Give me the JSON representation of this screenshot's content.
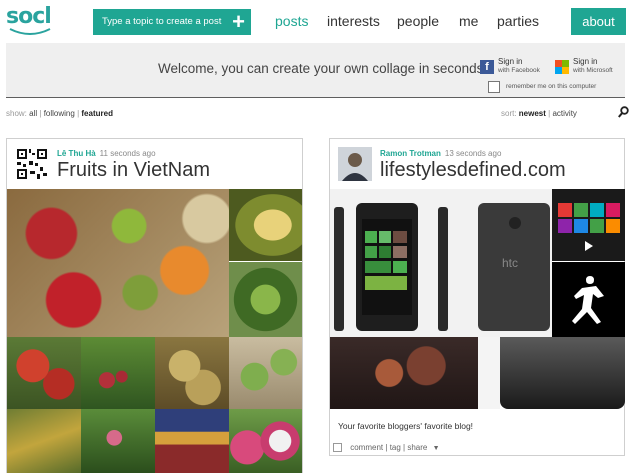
{
  "header": {
    "logo": "socl",
    "create_post": "Type a topic to create a post",
    "create_plus": "+",
    "nav": [
      "posts",
      "interests",
      "people",
      "me",
      "parties"
    ],
    "about": "about"
  },
  "welcome": {
    "text": "Welcome, you can create your own collage in seconds",
    "facebook": {
      "line1": "Sign in",
      "line2": "with Facebook"
    },
    "microsoft": {
      "line1": "Sign in",
      "line2": "with Microsoft"
    },
    "remember": "remember me on this computer"
  },
  "filters": {
    "show_label": "show:",
    "show_options": [
      "all",
      "following",
      "featured"
    ],
    "show_selected": "featured",
    "sort_label": "sort:",
    "sort_options": [
      "newest",
      "activity"
    ],
    "sort_selected": "newest"
  },
  "posts": [
    {
      "author": "Lê Thu Hà",
      "time": "11 seconds ago",
      "title": "Fruits in VietNam"
    },
    {
      "author": "Ramon Trotman",
      "time": "13 seconds ago",
      "title": "lifestylesdefined.com",
      "caption": "Your favorite bloggers' favorite blog!"
    }
  ],
  "actions": [
    "comment",
    "tag",
    "share"
  ],
  "icons": {
    "search": "search-icon",
    "facebook": "facebook-icon",
    "microsoft": "microsoft-icon",
    "qr": "qr-code-icon",
    "comment": "comment-icon",
    "dropdown": "chevron-down-icon"
  },
  "colors": {
    "accent": "#1fa693",
    "nav_active": "#1fa693"
  }
}
